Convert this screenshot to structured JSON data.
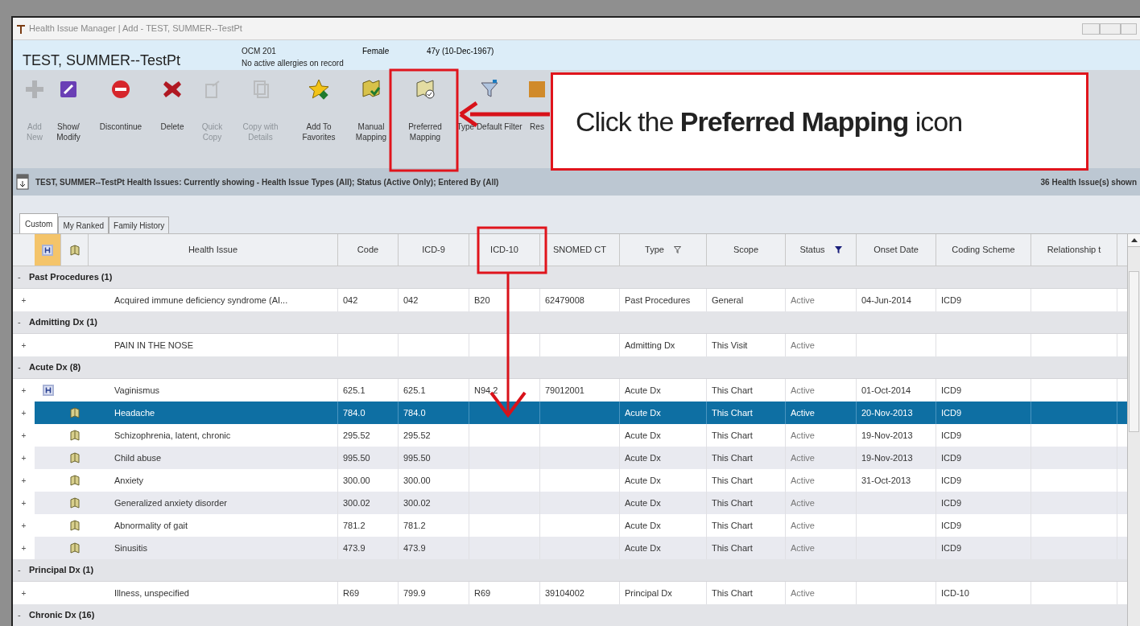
{
  "window": {
    "title": "Health Issue Manager | Add - TEST, SUMMER--TestPt"
  },
  "patient": {
    "name": "TEST, SUMMER--TestPt",
    "id": "OCM 201",
    "allergies": "No active allergies on record",
    "sex": "Female",
    "age": "47y (10-Dec-1967)"
  },
  "toolbar": [
    {
      "kind": "add",
      "label": "Add New",
      "disabled": true
    },
    {
      "kind": "edit",
      "label": "Show/ Modify",
      "disabled": false
    },
    {
      "kind": "stop",
      "label": "Discontinue",
      "disabled": false
    },
    {
      "kind": "delete",
      "label": "Delete",
      "disabled": false
    },
    {
      "kind": "copy",
      "label": "Quick Copy",
      "disabled": true
    },
    {
      "kind": "copy2",
      "label": "Copy with Details",
      "disabled": true
    },
    {
      "kind": "star",
      "label": "Add To Favorites",
      "disabled": false
    },
    {
      "kind": "map",
      "label": "Manual Mapping",
      "disabled": false
    },
    {
      "kind": "map2",
      "label": "Preferred Mapping",
      "disabled": false
    },
    {
      "kind": "filter",
      "label": "Type Default Filter",
      "disabled": false
    },
    {
      "kind": "reset",
      "label": "Res",
      "disabled": false
    }
  ],
  "filter_bar": {
    "text": "TEST, SUMMER--TestPt Health Issues: Currently showing - Health Issue Types (All); Status (Active Only); Entered By (All)",
    "count": "36 Health Issue(s) shown"
  },
  "tabs": [
    {
      "label": "Custom",
      "selected": true
    },
    {
      "label": "My Ranked",
      "selected": false
    },
    {
      "label": "Family History",
      "selected": false
    }
  ],
  "table": {
    "columns": [
      "Health Issue",
      "Code",
      "ICD-9",
      "ICD-10",
      "SNOMED CT",
      "Type",
      "Scope",
      "Status",
      "Onset Date",
      "Coding Scheme",
      "Relationship t"
    ],
    "groups": [
      {
        "toggle": "-",
        "label": "Past Procedures (1)",
        "rows": [
          {
            "toggle": "+",
            "h": false,
            "book": false,
            "selected": false,
            "cells": [
              "Acquired immune deficiency syndrome (AI...",
              "042",
              "042",
              "B20",
              "62479008",
              "Past Procedures",
              "General",
              "Active",
              "04-Jun-2014",
              "ICD9",
              ""
            ]
          }
        ]
      },
      {
        "toggle": "-",
        "label": "Admitting Dx (1)",
        "rows": [
          {
            "toggle": "+",
            "h": false,
            "book": false,
            "selected": false,
            "cells": [
              "PAIN IN THE NOSE",
              "",
              "",
              "",
              "",
              "Admitting Dx",
              "This Visit",
              "Active",
              "",
              "",
              ""
            ]
          }
        ]
      },
      {
        "toggle": "-",
        "label": "Acute Dx (8)",
        "rows": [
          {
            "toggle": "+",
            "h": true,
            "book": false,
            "selected": false,
            "cells": [
              "Vaginismus",
              "625.1",
              "625.1",
              "N94.2",
              "79012001",
              "Acute Dx",
              "This Chart",
              "Active",
              "01-Oct-2014",
              "ICD9",
              ""
            ]
          },
          {
            "toggle": "+",
            "h": false,
            "book": true,
            "selected": true,
            "cells": [
              "Headache",
              "784.0",
              "784.0",
              "",
              "",
              "Acute Dx",
              "This Chart",
              "Active",
              "20-Nov-2013",
              "ICD9",
              ""
            ]
          },
          {
            "toggle": "+",
            "h": false,
            "book": true,
            "selected": false,
            "cells": [
              "Schizophrenia, latent, chronic",
              "295.52",
              "295.52",
              "",
              "",
              "Acute Dx",
              "This Chart",
              "Active",
              "19-Nov-2013",
              "ICD9",
              ""
            ]
          },
          {
            "toggle": "+",
            "h": false,
            "book": true,
            "selected": false,
            "cells": [
              "Child abuse",
              "995.50",
              "995.50",
              "",
              "",
              "Acute Dx",
              "This Chart",
              "Active",
              "19-Nov-2013",
              "ICD9",
              ""
            ]
          },
          {
            "toggle": "+",
            "h": false,
            "book": true,
            "selected": false,
            "cells": [
              "Anxiety",
              "300.00",
              "300.00",
              "",
              "",
              "Acute Dx",
              "This Chart",
              "Active",
              "31-Oct-2013",
              "ICD9",
              ""
            ]
          },
          {
            "toggle": "+",
            "h": false,
            "book": true,
            "selected": false,
            "cells": [
              "Generalized anxiety disorder",
              "300.02",
              "300.02",
              "",
              "",
              "Acute Dx",
              "This Chart",
              "Active",
              "",
              "ICD9",
              ""
            ]
          },
          {
            "toggle": "+",
            "h": false,
            "book": true,
            "selected": false,
            "cells": [
              "Abnormality of gait",
              "781.2",
              "781.2",
              "",
              "",
              "Acute Dx",
              "This Chart",
              "Active",
              "",
              "ICD9",
              ""
            ]
          },
          {
            "toggle": "+",
            "h": false,
            "book": true,
            "selected": false,
            "cells": [
              "Sinusitis",
              "473.9",
              "473.9",
              "",
              "",
              "Acute Dx",
              "This Chart",
              "Active",
              "",
              "ICD9",
              ""
            ]
          }
        ]
      },
      {
        "toggle": "-",
        "label": "Principal Dx (1)",
        "rows": [
          {
            "toggle": "+",
            "h": false,
            "book": false,
            "selected": false,
            "cells": [
              "Illness, unspecified",
              "R69",
              "799.9",
              "R69",
              "39104002",
              "Principal Dx",
              "This Chart",
              "Active",
              "",
              "ICD-10",
              ""
            ]
          }
        ]
      },
      {
        "toggle": "-",
        "label": "Chronic Dx (16)"
      }
    ]
  },
  "callout": {
    "text": "Click the **Preferred Mapping** icon"
  }
}
